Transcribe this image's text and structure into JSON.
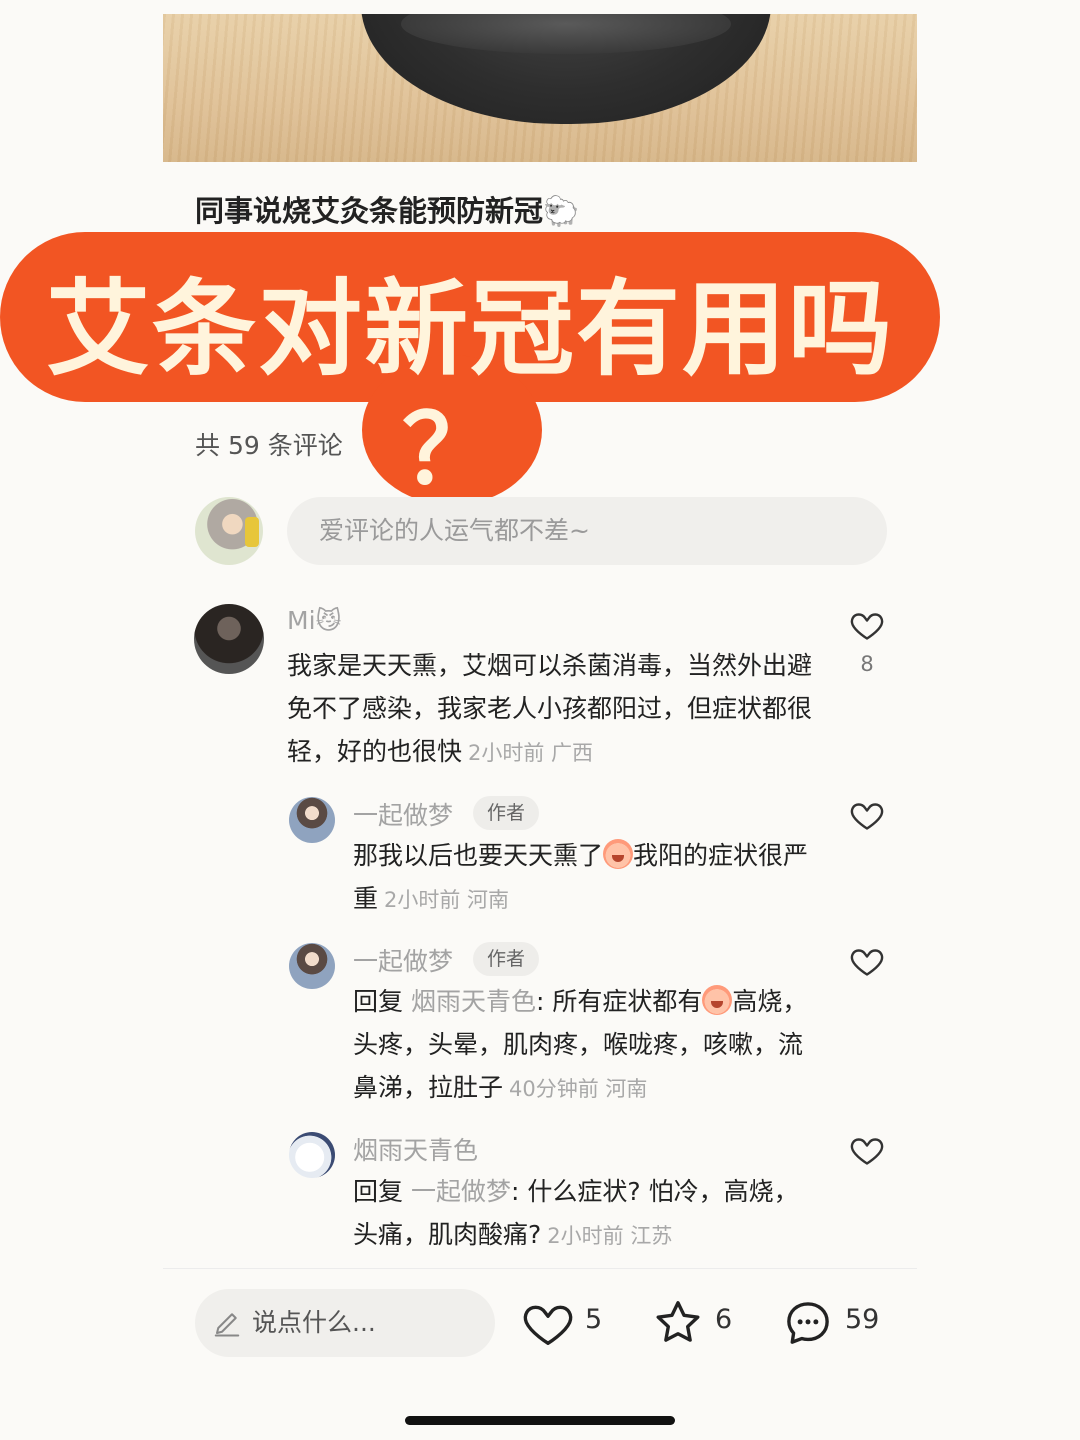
{
  "post": {
    "title": "同事说烧艾灸条能预防新冠🐑"
  },
  "overlay": {
    "headline": "艾条对新冠有用吗",
    "question_mark": "？",
    "color": "#f25523"
  },
  "comments_section": {
    "count_label": "共 59 条评论",
    "input_placeholder": "爱评论的人运气都不差~"
  },
  "comments": [
    {
      "user": "Mi😼",
      "text": "我家是天天熏，艾烟可以杀菌消毒，当然外出避免不了感染，我家老人小孩都阳过，但症状都很轻，好的也很快",
      "meta": "2小时前 广西",
      "likes": "8"
    }
  ],
  "replies": [
    {
      "user": "一起做梦",
      "badge": "作者",
      "text_a": "那我以后也要天天熏了",
      "text_b": "我阳的症状很严重",
      "meta": "2小时前 河南"
    },
    {
      "user": "一起做梦",
      "badge": "作者",
      "reply_prefix": "回复",
      "reply_to": "烟雨天青色",
      "text_a": ": 所有症状都有",
      "text_b": "高烧，头疼，头晕，肌肉疼，喉咙疼，咳嗽，流鼻涕，拉肚子",
      "meta": "40分钟前 河南"
    },
    {
      "user": "烟雨天青色",
      "reply_prefix": "回复",
      "reply_to": "一起做梦",
      "text_a": ": 什么症状? 怕冷，高烧，头痛，肌肉酸痛?",
      "meta": "2小时前 江苏"
    }
  ],
  "bottom_bar": {
    "input_label": "说点什么...",
    "likes": "5",
    "favorites": "6",
    "comments": "59"
  },
  "icons": {
    "like": "heart-icon",
    "favorite": "star-icon",
    "comment": "chat-bubble-icon",
    "edit": "pencil-icon"
  }
}
